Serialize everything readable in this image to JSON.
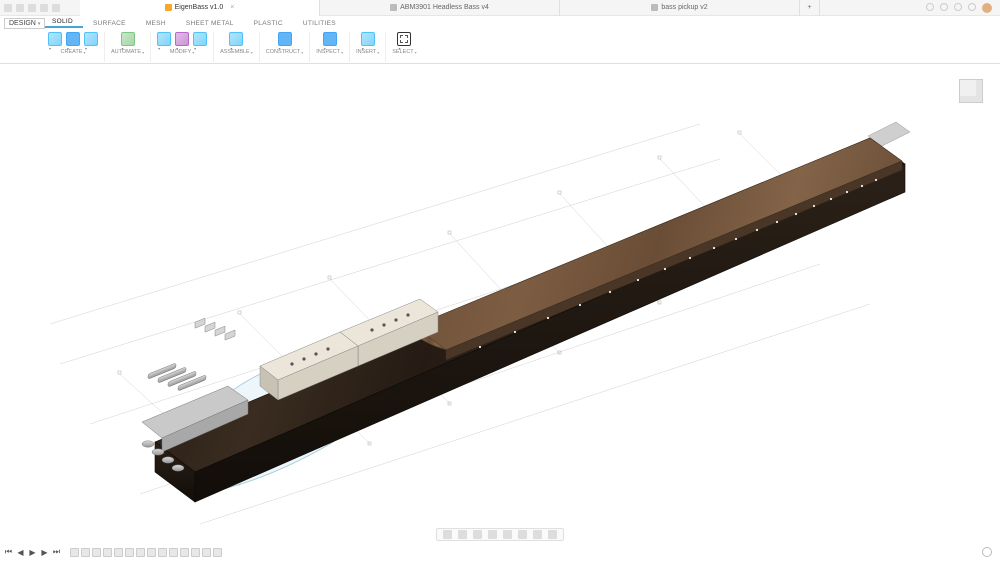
{
  "title_tabs": [
    {
      "label": "EigenBass v1.0",
      "active": true
    },
    {
      "label": "ABM3901 Headless Bass v4",
      "active": false
    },
    {
      "label": "bass pickup v2",
      "active": false
    }
  ],
  "design_button": "DESIGN",
  "workspace_tabs": [
    {
      "label": "SOLID",
      "active": true
    },
    {
      "label": "SURFACE",
      "active": false
    },
    {
      "label": "MESH",
      "active": false
    },
    {
      "label": "SHEET METAL",
      "active": false
    },
    {
      "label": "PLASTIC",
      "active": false
    },
    {
      "label": "UTILITIES",
      "active": false
    }
  ],
  "ribbon_groups": [
    {
      "name": "CREATE",
      "icons": 3
    },
    {
      "name": "AUTOMATE",
      "icons": 1
    },
    {
      "name": "MODIFY",
      "icons": 3
    },
    {
      "name": "ASSEMBLE",
      "icons": 1
    },
    {
      "name": "CONSTRUCT",
      "icons": 1
    },
    {
      "name": "INSPECT",
      "icons": 1
    },
    {
      "name": "INSERT",
      "icons": 1
    },
    {
      "name": "SELECT",
      "icons": 1
    }
  ],
  "nav_tools": [
    "orbit",
    "look",
    "pan",
    "zoom",
    "fit",
    "display",
    "grid",
    "viewports"
  ],
  "timeline_controls": [
    "start",
    "back",
    "play",
    "fwd",
    "end"
  ],
  "timeline_features_count": 14,
  "viewport": {
    "description": "3D isometric view of a headless bass guitar CAD model: long dark stained wood body/neck blank, lighter brown fretboard on top with small white side/fret dots, two light-colored rectangular pickup blocks with mounting holes near the body end, and a 4-saddle headless bridge/tuner unit at the tail. Pale blue body outline sketch visible underneath, plus faint grey construction line grid."
  }
}
